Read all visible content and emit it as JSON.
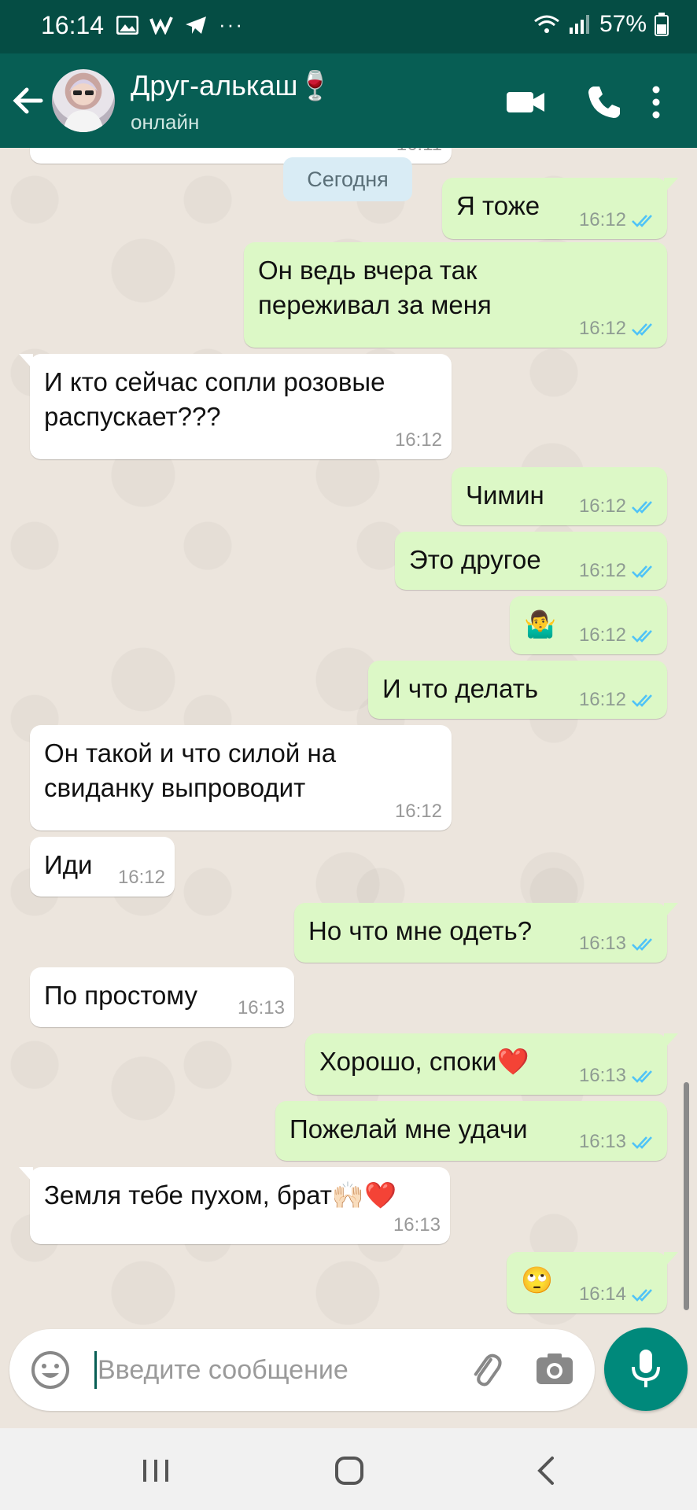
{
  "status_bar": {
    "time": "16:14",
    "battery": "57%"
  },
  "header": {
    "contact_name": "Друг-алькаш🍷",
    "contact_status": "онлайн"
  },
  "chat": {
    "partial_time": "16:11",
    "date_chip": "Сегодня",
    "messages": [
      {
        "dir": "out",
        "text": "Я  тоже",
        "time": "16:12"
      },
      {
        "dir": "out",
        "text": "Он ведь вчера так\nпереживал за меня",
        "time": "16:12"
      },
      {
        "dir": "in",
        "text": "И кто сейчас сопли розовые\nраспускает???",
        "time": "16:12"
      },
      {
        "dir": "out",
        "text": "Чимин",
        "time": "16:12"
      },
      {
        "dir": "out",
        "text": "Это другое",
        "time": "16:12"
      },
      {
        "dir": "out",
        "text": "🤷‍♂️",
        "time": "16:12"
      },
      {
        "dir": "out",
        "text": "И что делать",
        "time": "16:12"
      },
      {
        "dir": "in",
        "text": "Он такой и что силой на\nсвиданку выпроводит",
        "time": "16:12"
      },
      {
        "dir": "in",
        "text": "Иди",
        "time": "16:12"
      },
      {
        "dir": "out",
        "text": "Но что мне одеть?",
        "time": "16:13"
      },
      {
        "dir": "in",
        "text": "По простому",
        "time": "16:13"
      },
      {
        "dir": "out",
        "text": "Хорошо, споки❤️",
        "time": "16:13"
      },
      {
        "dir": "out",
        "text": "Пожелай мне удачи",
        "time": "16:13"
      },
      {
        "dir": "in",
        "text": "Земля тебе пухом, брат🙌🏻❤️",
        "time": "16:13"
      },
      {
        "dir": "out",
        "text": "🙄",
        "time": "16:14"
      }
    ]
  },
  "composer": {
    "placeholder": "Введите сообщение",
    "value": ""
  },
  "colors": {
    "header": "#075e54",
    "status_bar": "#054d44",
    "outgoing_bubble": "#dcf8c6",
    "incoming_bubble": "#ffffff",
    "read_tick": "#4fc3f7",
    "mic_button": "#00897b"
  },
  "icons": [
    "back-arrow-icon",
    "video-call-icon",
    "phone-icon",
    "more-vert-icon",
    "emoji-icon",
    "attach-icon",
    "camera-icon",
    "mic-icon",
    "read-receipt-icon",
    "nav-recents-icon",
    "nav-home-icon",
    "nav-back-icon"
  ]
}
